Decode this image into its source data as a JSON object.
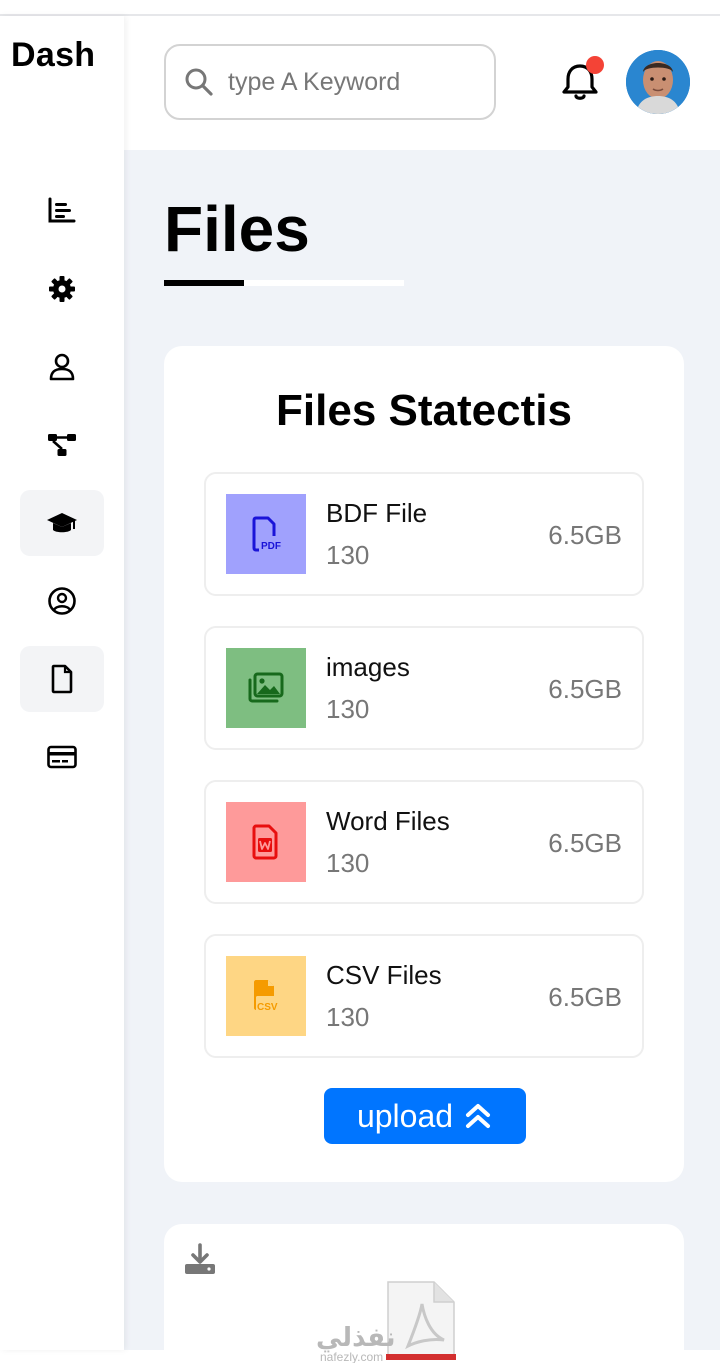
{
  "brand": "Dash",
  "search": {
    "placeholder": "type A Keyword"
  },
  "sidebar": {
    "items": [
      {
        "icon": "chart-bar-icon",
        "active": false
      },
      {
        "icon": "gear-icon",
        "active": false
      },
      {
        "icon": "user-icon",
        "active": false
      },
      {
        "icon": "diagram-project-icon",
        "active": false
      },
      {
        "icon": "graduation-cap-icon",
        "active": true
      },
      {
        "icon": "user-circle-icon",
        "active": false
      },
      {
        "icon": "file-icon",
        "active": true
      },
      {
        "icon": "credit-card-icon",
        "active": false
      }
    ]
  },
  "page": {
    "title": "Files"
  },
  "stats": {
    "title": "Files Statectis",
    "files": [
      {
        "name": "BDF File",
        "count": "130",
        "size": "6.5GB",
        "icon": "pdf-file-icon",
        "bg": "#a0a1fd",
        "color": "#1a14d8"
      },
      {
        "name": "images",
        "count": "130",
        "size": "6.5GB",
        "icon": "images-icon",
        "bg": "#7ebe81",
        "color": "#17691c"
      },
      {
        "name": "Word Files",
        "count": "130",
        "size": "6.5GB",
        "icon": "word-file-icon",
        "bg": "#fe9a9a",
        "color": "#e80f0f"
      },
      {
        "name": "CSV Files",
        "count": "130",
        "size": "6.5GB",
        "icon": "csv-file-icon",
        "bg": "#fed684",
        "color": "#f59b00"
      }
    ],
    "upload_label": "upload"
  },
  "colors": {
    "accent": "#0075ff",
    "page_bg": "#f0f3f8",
    "notification_dot": "#f44336"
  },
  "watermark": {
    "text": "نفذلي",
    "sub": "nafezly.com"
  }
}
